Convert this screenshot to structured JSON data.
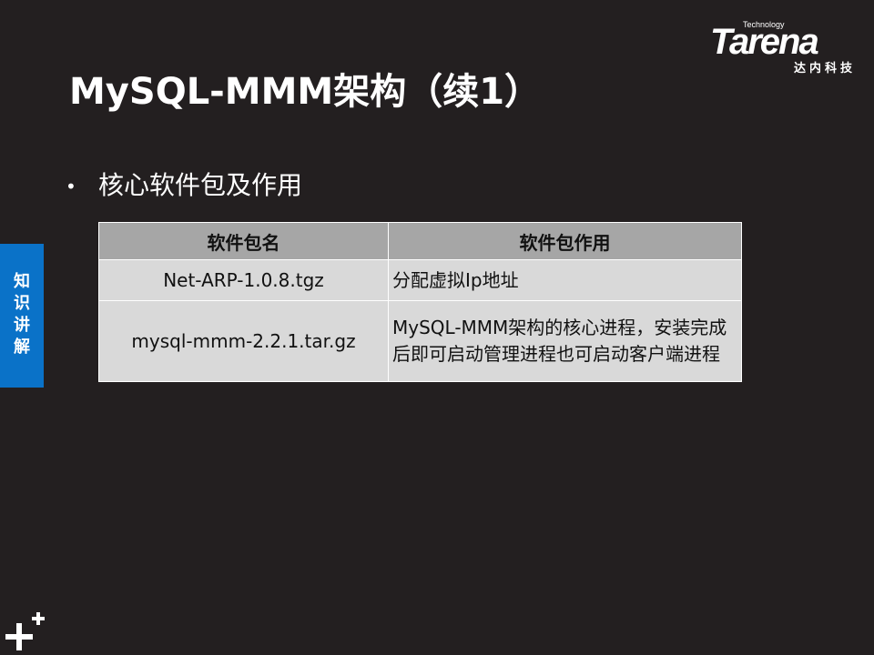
{
  "slide": {
    "title": "MySQL-MMM架构（续1）",
    "bullet": "核心软件包及作用",
    "side_tab": [
      "知",
      "识",
      "讲",
      "解"
    ]
  },
  "logo": {
    "tech": "Technology",
    "word": "Tarena",
    "cn": "达内科技"
  },
  "table": {
    "headers": [
      "软件包名",
      "软件包作用"
    ],
    "rows": [
      {
        "name": "Net-ARP-1.0.8.tgz",
        "desc": "分配虚拟Ip地址"
      },
      {
        "name": "mysql-mmm-2.2.1.tar.gz",
        "desc": "MySQL-MMM架构的核心进程，安装完成后即可启动管理进程也可启动客户端进程"
      }
    ]
  },
  "colors": {
    "background": "#231f20",
    "side_tab": "#0a72c8",
    "table_header": "#a6a6a6",
    "table_cell": "#d9d9d9"
  },
  "icons": {
    "bottom_left": "plus-icon"
  }
}
